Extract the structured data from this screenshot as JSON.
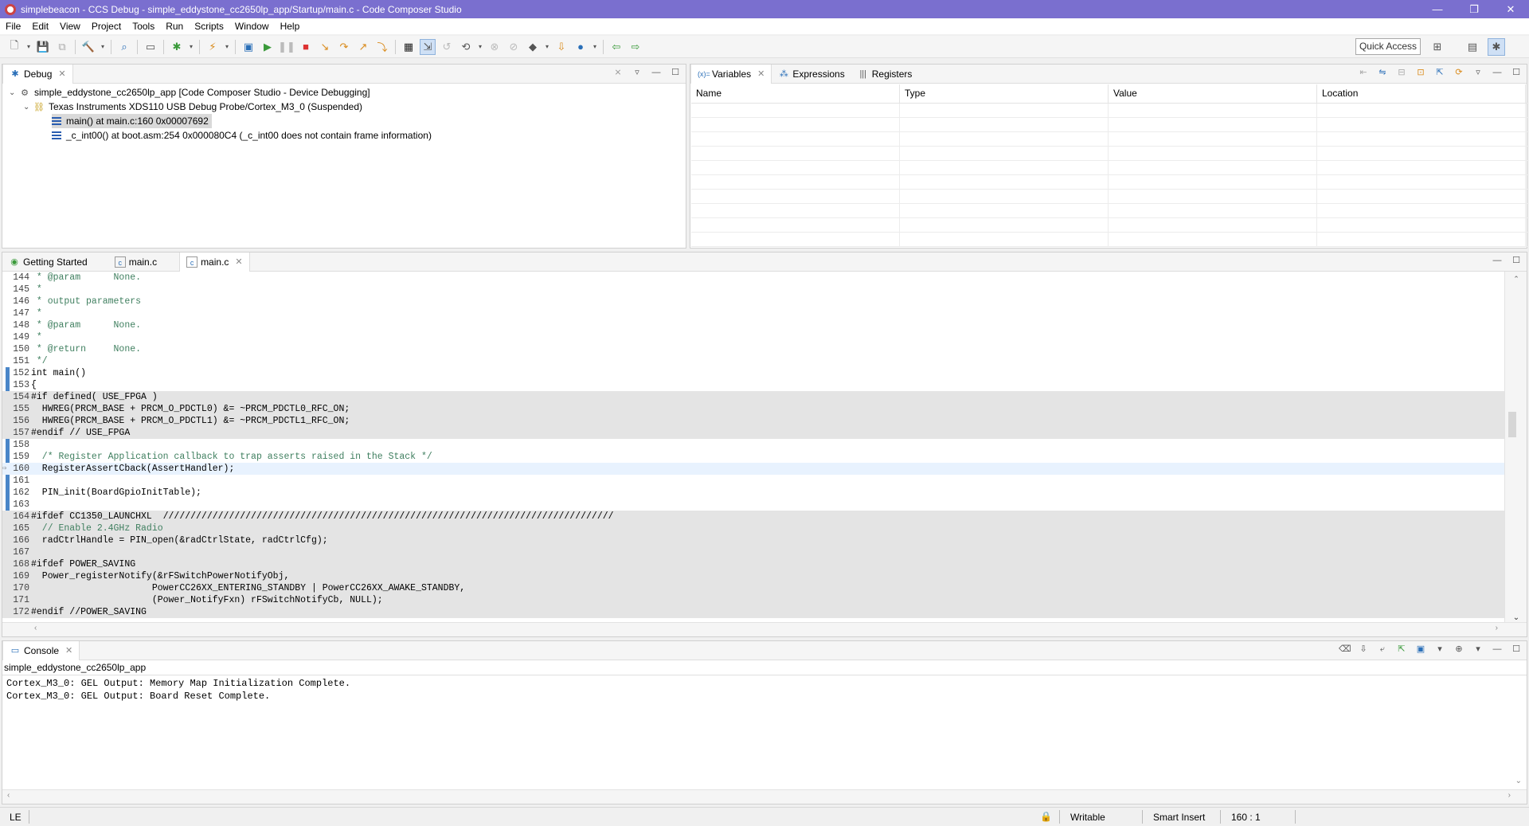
{
  "window": {
    "title": "simplebeacon - CCS Debug - simple_eddystone_cc2650lp_app/Startup/main.c - Code Composer Studio",
    "minimize": "—",
    "restore": "❐",
    "close": "✕"
  },
  "menu": [
    "File",
    "Edit",
    "View",
    "Project",
    "Tools",
    "Run",
    "Scripts",
    "Window",
    "Help"
  ],
  "toolbar": {
    "quick_access": "Quick Access"
  },
  "debug_view": {
    "tab_label": "Debug",
    "items": [
      {
        "label": "simple_eddystone_cc2650lp_app [Code Composer Studio - Device Debugging]"
      },
      {
        "label": "Texas Instruments XDS110 USB Debug Probe/Cortex_M3_0 (Suspended)"
      },
      {
        "label": "main() at main.c:160 0x00007692"
      },
      {
        "label": "_c_int00() at boot.asm:254 0x000080C4  (_c_int00 does not contain frame information)"
      }
    ]
  },
  "variables_view": {
    "tabs": [
      "Variables",
      "Expressions",
      "Registers"
    ],
    "columns": [
      "Name",
      "Type",
      "Value",
      "Location"
    ]
  },
  "editor": {
    "tabs": [
      "Getting Started",
      "main.c",
      "main.c"
    ],
    "lines": [
      {
        "n": "144",
        "text": " * @param      None."
      },
      {
        "n": "145",
        "text": " *"
      },
      {
        "n": "146",
        "text": " * output parameters"
      },
      {
        "n": "147",
        "text": " *"
      },
      {
        "n": "148",
        "text": " * @param      None."
      },
      {
        "n": "149",
        "text": " *"
      },
      {
        "n": "150",
        "text": " * @return     None."
      },
      {
        "n": "151",
        "text": " */"
      },
      {
        "n": "152",
        "text": "int main()"
      },
      {
        "n": "153",
        "text": "{"
      },
      {
        "n": "154",
        "text": "#if defined( USE_FPGA )"
      },
      {
        "n": "155",
        "text": "  HWREG(PRCM_BASE + PRCM_O_PDCTL0) &= ~PRCM_PDCTL0_RFC_ON;"
      },
      {
        "n": "156",
        "text": "  HWREG(PRCM_BASE + PRCM_O_PDCTL1) &= ~PRCM_PDCTL1_RFC_ON;"
      },
      {
        "n": "157",
        "text": "#endif // USE_FPGA"
      },
      {
        "n": "158",
        "text": ""
      },
      {
        "n": "159",
        "text": "  /* Register Application callback to trap asserts raised in the Stack */"
      },
      {
        "n": "160",
        "text": "  RegisterAssertCback(AssertHandler);"
      },
      {
        "n": "161",
        "text": ""
      },
      {
        "n": "162",
        "text": "  PIN_init(BoardGpioInitTable);"
      },
      {
        "n": "163",
        "text": ""
      },
      {
        "n": "164",
        "text": "#ifdef CC1350_LAUNCHXL  //////////////////////////////////////////////////////////////////////////////////"
      },
      {
        "n": "165",
        "text": "  // Enable 2.4GHz Radio"
      },
      {
        "n": "166",
        "text": "  radCtrlHandle = PIN_open(&radCtrlState, radCtrlCfg);"
      },
      {
        "n": "167",
        "text": ""
      },
      {
        "n": "168",
        "text": "#ifdef POWER_SAVING"
      },
      {
        "n": "169",
        "text": "  Power_registerNotify(&rFSwitchPowerNotifyObj,"
      },
      {
        "n": "170",
        "text": "                      PowerCC26XX_ENTERING_STANDBY | PowerCC26XX_AWAKE_STANDBY,"
      },
      {
        "n": "171",
        "text": "                      (Power_NotifyFxn) rFSwitchNotifyCb, NULL);"
      },
      {
        "n": "172",
        "text": "#endif //POWER_SAVING"
      }
    ]
  },
  "console": {
    "tab_label": "Console",
    "title": "simple_eddystone_cc2650lp_app",
    "lines": [
      "Cortex_M3_0: GEL Output: Memory Map Initialization Complete.",
      "Cortex_M3_0: GEL Output: Board Reset Complete."
    ]
  },
  "status_bar": {
    "encoding": "LE",
    "writable": "Writable",
    "insert_mode": "Smart Insert",
    "position": "160 : 1"
  }
}
